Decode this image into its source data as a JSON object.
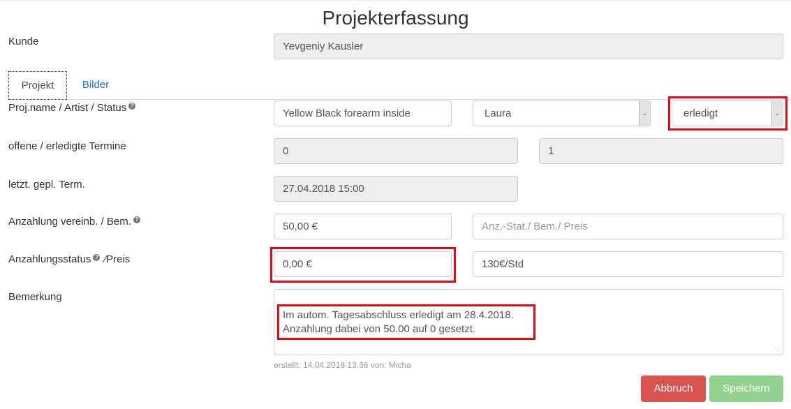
{
  "page": {
    "title": "Projekterfassung"
  },
  "kunde": {
    "label": "Kunde",
    "value": "Yevgeniy Kausler"
  },
  "tabs": [
    {
      "label": "Projekt",
      "active": true
    },
    {
      "label": "Bilder",
      "active": false
    }
  ],
  "rows": {
    "projname": {
      "label": "Proj.name / Artist / Status",
      "help_icon": "question-circle-icon",
      "name_value": "Yellow Black forearm inside",
      "artist_value": "Laura",
      "status_value": "erledigt"
    },
    "termine": {
      "label": "offene / erledigte Termine",
      "open_value": "0",
      "done_value": "1"
    },
    "last_term": {
      "label": "letzt. gepl. Term.",
      "value": "27.04.2018 15:00"
    },
    "anzahlung": {
      "label": "Anzahlung vereinb. / Bem.",
      "help_icon": "question-circle-icon",
      "value": "50,00 €",
      "remark_placeholder": "Anz.-Stat./ Bem./ Preis"
    },
    "anzahlungsstatus": {
      "label_part1": "Anzahlungsstatus",
      "label_part2": "⁄Preis",
      "help_icon": "question-circle-icon",
      "status_value": "0,00 €",
      "price_value": "130€/Std"
    },
    "bemerkung": {
      "label": "Bemerkung",
      "line1": "Im autom. Tagesabschluss erledigt am 28.4.2018.",
      "line2": "Anzahlung dabei von 50.00 auf 0 gesetzt."
    }
  },
  "meta": {
    "created": "erstellt: 14.04.2018 13:36 von: Micha"
  },
  "buttons": {
    "cancel": {
      "label": "Abbruch",
      "color": "#d9534f"
    },
    "save": {
      "label": "Speichern",
      "color": "#92d28f"
    }
  },
  "highlight_color": "#e8080f"
}
